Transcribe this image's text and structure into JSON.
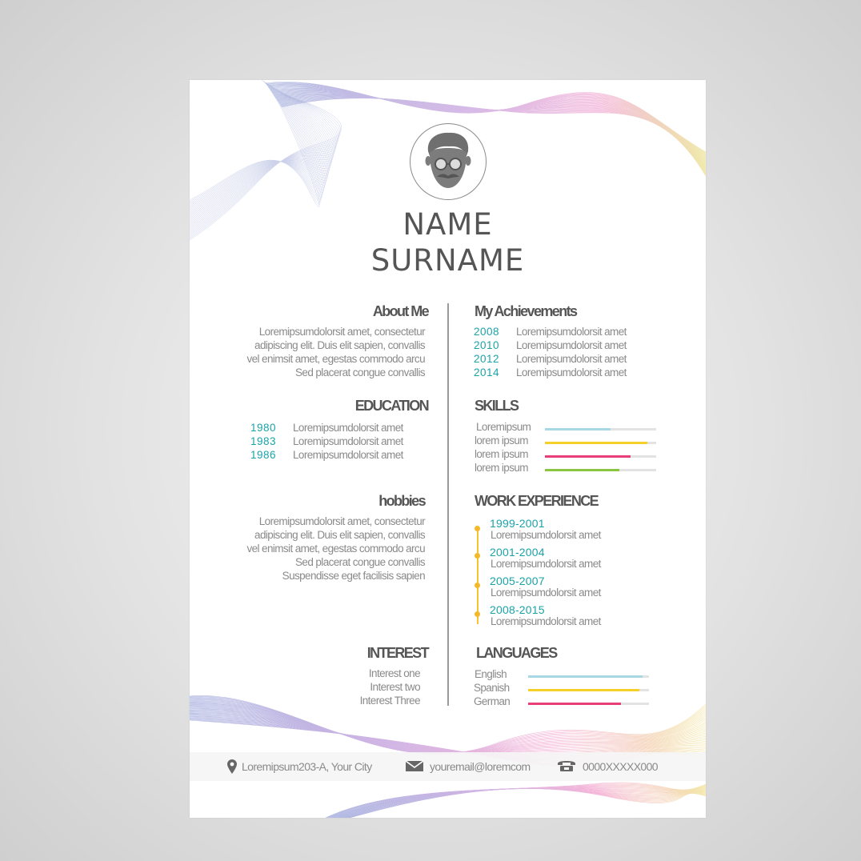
{
  "name": {
    "first": "NAME",
    "last": "SURNAME"
  },
  "about": {
    "heading": "About Me",
    "lines": [
      "Loremipsumdolorsit amet, consectetur",
      "adipiscing elit. Duis elit sapien, convallis",
      "vel enimsit amet, egestas commodo arcu",
      "Sed placerat congue convallis"
    ]
  },
  "education": {
    "heading": "EDUCATION",
    "items": [
      {
        "year": "1980",
        "text": "Loremipsumdolorsit amet"
      },
      {
        "year": "1983",
        "text": "Loremipsumdolorsit amet"
      },
      {
        "year": "1986",
        "text": "Loremipsumdolorsit amet"
      }
    ]
  },
  "hobbies": {
    "heading": "hobbies",
    "lines": [
      "Loremipsumdolorsit amet, consectetur",
      "adipiscing elit. Duis elit sapien, convallis",
      "vel enimsit amet, egestas commodo arcu",
      "Sed placerat congue convallis",
      "Suspendisse eget facilisis sapien"
    ]
  },
  "interest": {
    "heading": "INTEREST",
    "items": [
      "Interest one",
      "Interest two",
      "Interest Three"
    ]
  },
  "achievements": {
    "heading": "My Achievements",
    "items": [
      {
        "year": "2008",
        "text": "Loremipsumdolorsit amet"
      },
      {
        "year": "2010",
        "text": "Loremipsumdolorsit amet"
      },
      {
        "year": "2012",
        "text": "Loremipsumdolorsit amet"
      },
      {
        "year": "2014",
        "text": "Loremipsumdolorsit amet"
      }
    ]
  },
  "skills": {
    "heading": "SKILLS",
    "items": [
      {
        "label": "Loremipsum",
        "level": 0.59,
        "color": "#a8d8e6"
      },
      {
        "label": "lorem ipsum",
        "level": 0.92,
        "color": "#f5cf2a"
      },
      {
        "label": "lorem ipsum",
        "level": 0.77,
        "color": "#e83e7a"
      },
      {
        "label": "lorem ipsum",
        "level": 0.67,
        "color": "#8cc541"
      }
    ]
  },
  "work": {
    "heading": "WORK EXPERIENCE",
    "items": [
      {
        "years": "1999-2001",
        "text": "Loremipsumdolorsit amet"
      },
      {
        "years": "2001-2004",
        "text": "Loremipsumdolorsit amet"
      },
      {
        "years": "2005-2007",
        "text": "Loremipsumdolorsit amet"
      },
      {
        "years": "2008-2015",
        "text": "Loremipsumdolorsit amet"
      }
    ]
  },
  "languages": {
    "heading": "LANGUAGES",
    "items": [
      {
        "label": "English",
        "level": 0.95,
        "color": "#a8d8e6"
      },
      {
        "label": "Spanish",
        "level": 0.92,
        "color": "#f5cf2a"
      },
      {
        "label": "German",
        "level": 0.77,
        "color": "#e83e7a"
      }
    ]
  },
  "contact": {
    "address": "Loremipsum203-A, Your City",
    "email": "youremail@loremcom",
    "phone": "0000XXXXX000",
    "address_icon": "location-pin-icon",
    "email_icon": "envelope-icon",
    "phone_icon": "telephone-icon"
  }
}
